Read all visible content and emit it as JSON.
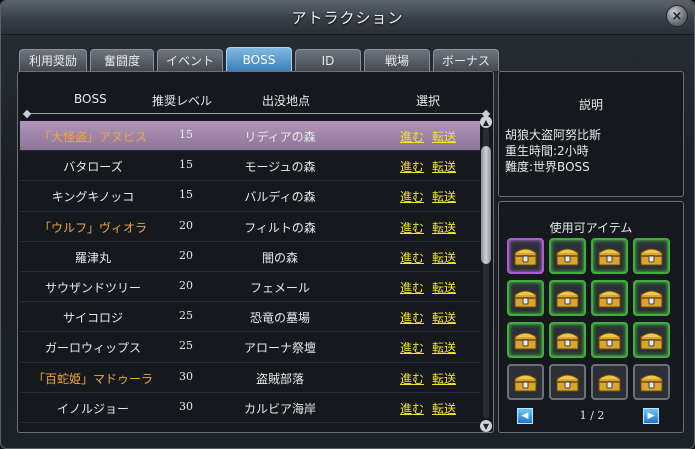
{
  "window": {
    "title": "アトラクション",
    "close_label": "×"
  },
  "tabs": [
    "利用奨励",
    "奮闘度",
    "イベント",
    "BOSS",
    "ID",
    "戦場",
    "ボーナス"
  ],
  "active_tab": "BOSS",
  "table": {
    "headers": {
      "boss": "BOSS",
      "level": "推奨レベル",
      "location": "出没地点",
      "select": "選択"
    },
    "go_label": "進む",
    "warp_label": "転送",
    "rows": [
      {
        "name": "「大怪盗」アヌビス",
        "level": "15",
        "location": "リディアの森",
        "named": true,
        "selected": true
      },
      {
        "name": "バタローズ",
        "level": "15",
        "location": "モージュの森",
        "named": false,
        "selected": false
      },
      {
        "name": "キングキノッコ",
        "level": "15",
        "location": "バルディの森",
        "named": false,
        "selected": false
      },
      {
        "name": "「ウルフ」ヴィオラ",
        "level": "20",
        "location": "フィルトの森",
        "named": true,
        "selected": false
      },
      {
        "name": "羅津丸",
        "level": "20",
        "location": "闇の森",
        "named": false,
        "selected": false
      },
      {
        "name": "サウザンドツリー",
        "level": "20",
        "location": "フェメール",
        "named": false,
        "selected": false
      },
      {
        "name": "サイコロジ",
        "level": "25",
        "location": "恐竜の墓場",
        "named": false,
        "selected": false
      },
      {
        "name": "ガーロウィップス",
        "level": "25",
        "location": "アローナ祭壇",
        "named": false,
        "selected": false
      },
      {
        "name": "「百蛇姫」マドゥーラ",
        "level": "30",
        "location": "盗賊部落",
        "named": true,
        "selected": false
      },
      {
        "name": "イノルジョー",
        "level": "30",
        "location": "カルビア海岸",
        "named": false,
        "selected": false
      }
    ]
  },
  "description": {
    "title": "説明",
    "lines": [
      "胡狼大盗阿努比斯",
      "重生時間:2小時",
      "難度:世界BOSS"
    ]
  },
  "items": {
    "title": "使用可アイテム",
    "slot_borders": [
      "purple",
      "green",
      "green",
      "green",
      "green",
      "green",
      "green",
      "green",
      "green",
      "green",
      "green",
      "green",
      "plain",
      "plain",
      "plain",
      "plain"
    ],
    "page": "1 / 2"
  }
}
